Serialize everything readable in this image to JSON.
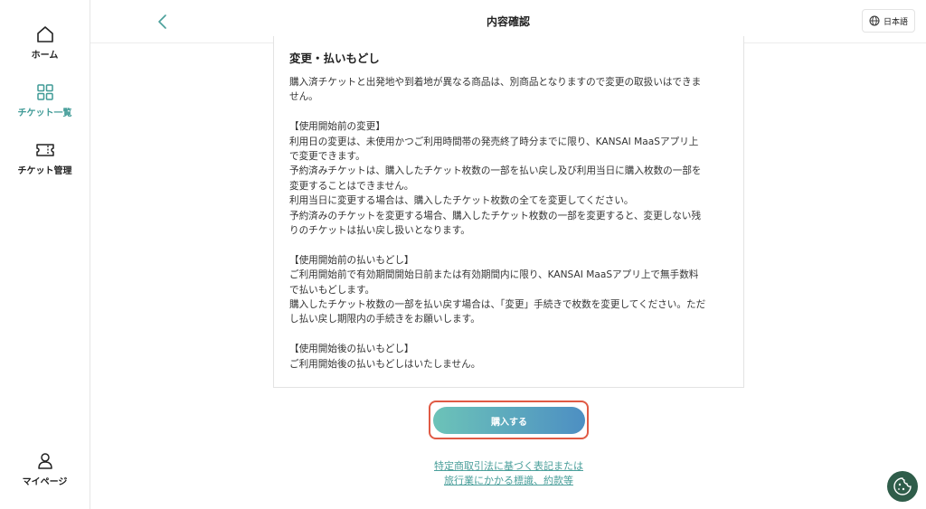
{
  "sidebar": {
    "items": [
      {
        "label": "ホーム",
        "icon": "home-icon"
      },
      {
        "label": "チケット一覧",
        "icon": "grid-icon",
        "active": true
      },
      {
        "label": "チケット管理",
        "icon": "ticket-icon"
      },
      {
        "label": "マイページ",
        "icon": "user-icon"
      }
    ]
  },
  "header": {
    "title": "内容確認",
    "language": "日本語"
  },
  "content": {
    "heading": "変更・払いもどし",
    "intro": [
      "購入済チケットと出発地や到着地が異なる商品は、別商品となりますので変更の取扱いはできま",
      "せん。"
    ],
    "section1": {
      "title": "【使用開始前の変更】",
      "lines": [
        "利用日の変更は、未使用かつご利用時間帯の発売終了時分までに限り、KANSAI MaaSアプリ上",
        "で変更できます。",
        "予約済みチケットは、購入したチケット枚数の一部を払い戻し及び利用当日に購入枚数の一部を",
        "変更することはできません。",
        "利用当日に変更する場合は、購入したチケット枚数の全てを変更してください。",
        "予約済みのチケットを変更する場合、購入したチケット枚数の一部を変更すると、変更しない残",
        "りのチケットは払い戻し扱いとなります。"
      ]
    },
    "section2": {
      "title": "【使用開始前の払いもどし】",
      "lines": [
        "ご利用開始前で有効期間開始日前または有効期間内に限り、KANSAI MaaSアプリ上で無手数料",
        "で払いもどします。",
        "購入したチケット枚数の一部を払い戻す場合は、「変更」手続きで枚数を変更してください。ただ",
        "し払い戻し期限内の手続きをお願いします。"
      ]
    },
    "section3": {
      "title": "【使用開始後の払いもどし】",
      "lines": [
        "ご利用開始後の払いもどしはいたしません。"
      ]
    }
  },
  "actions": {
    "buy_label": "購入する",
    "highlight_color": "#e05a45"
  },
  "links": {
    "line1": "特定商取引法に基づく表記または",
    "line2": "旅行業にかかる標識、約款等"
  },
  "colors": {
    "accent": "#3f9a96",
    "button_gradient_start": "#6cc3b8",
    "button_gradient_end": "#4d8fc3"
  }
}
